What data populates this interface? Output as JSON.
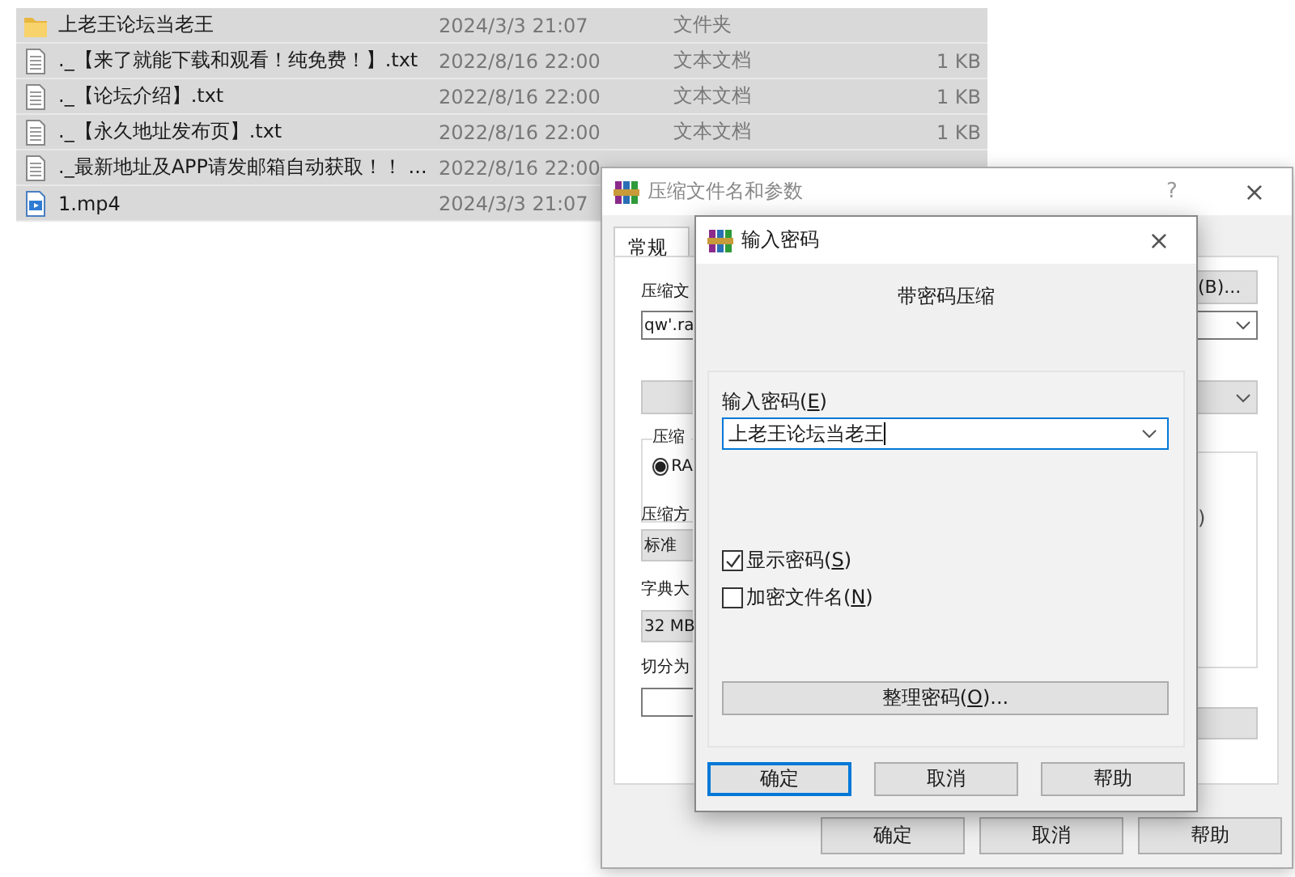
{
  "files": [
    {
      "kind": "folder",
      "name": "上老王论坛当老王",
      "date": "2024/3/3 21:07",
      "type": "文件夹"
    },
    {
      "kind": "text",
      "name": "._【来了就能下载和观看！纯免费！】.txt",
      "date": "2022/8/16 22:00",
      "type": "文本文档",
      "size": "1 KB"
    },
    {
      "kind": "text",
      "name": "._【论坛介绍】.txt",
      "date": "2022/8/16 22:00",
      "type": "文本文档",
      "size": "1 KB"
    },
    {
      "kind": "text",
      "name": "._【永久地址发布页】.txt",
      "date": "2022/8/16 22:00",
      "type": "文本文档",
      "size": "1 KB"
    },
    {
      "kind": "text",
      "name": "._最新地址及APP请发邮箱自动获取！！ ...",
      "date": "2022/8/16 22:00"
    },
    {
      "kind": "video",
      "name": "1.mp4",
      "date": "2024/3/3 21:07"
    }
  ],
  "archive_dialog": {
    "title": "压缩文件名和参数",
    "help_glyph": "?",
    "close_glyph": "×",
    "tabs": [
      {
        "label": "常规",
        "selected": true
      }
    ],
    "left": {
      "name_label": "压缩文",
      "name_value": "qw'.ra",
      "format_legend": "压缩",
      "format_radio": {
        "label": "RA",
        "selected": true
      },
      "method_label": "压缩方",
      "method_value": "标准",
      "dict_label": "字典大",
      "dict_value": "32 MB",
      "split_label": "切分为"
    },
    "right": {
      "browse_button": "(B)...",
      "group_text": ")"
    },
    "buttons": [
      "确定",
      "取消",
      "帮助"
    ]
  },
  "password_dialog": {
    "title": "输入密码",
    "close_glyph": "×",
    "heading": "带密码压缩",
    "password_label": {
      "before": "输入密码(",
      "key": "E",
      "after": ")"
    },
    "password_value": "上老王论坛当老王",
    "checkboxes": [
      {
        "before": "显示密码(",
        "key": "S",
        "after": ")",
        "checked": true
      },
      {
        "before": "加密文件名(",
        "key": "N",
        "after": ")",
        "checked": false
      }
    ],
    "manage_button": {
      "before": "整理密码(",
      "key": "O",
      "after": ")..."
    },
    "buttons": [
      {
        "label": "确定",
        "selected": true
      },
      {
        "label": "取消",
        "selected": false
      },
      {
        "label": "帮助",
        "selected": false
      }
    ]
  }
}
